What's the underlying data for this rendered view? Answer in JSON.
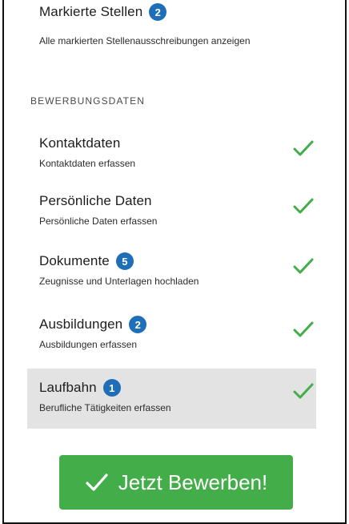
{
  "saved_jobs": {
    "title": "Markierte Stellen",
    "count": "2",
    "description": "Alle markierten Stellenausschreibungen anzeigen"
  },
  "section": {
    "header": "BEWERBUNGSDATEN"
  },
  "steps": [
    {
      "title": "Kontaktdaten",
      "badge": "",
      "description": "Kontaktdaten erfassen",
      "completed": true
    },
    {
      "title": "Persönliche Daten",
      "badge": "",
      "description": "Persönliche Daten erfassen",
      "completed": true
    },
    {
      "title": "Dokumente",
      "badge": "5",
      "description": "Zeugnisse und Unterlagen hochladen",
      "completed": true
    },
    {
      "title": "Ausbildungen",
      "badge": "2",
      "description": "Ausbildungen erfassen",
      "completed": true
    },
    {
      "title": "Laufbahn",
      "badge": "1",
      "description": "Berufliche Tätigkeiten erfassen",
      "completed": true,
      "active": true
    }
  ],
  "apply_button": {
    "label": "Jetzt Bewerben!",
    "icon": "checkmark-icon"
  },
  "colors": {
    "badge": "#1f6fb8",
    "check": "#43ad49",
    "button": "#43ad49",
    "active_row": "#e3e3e3"
  }
}
